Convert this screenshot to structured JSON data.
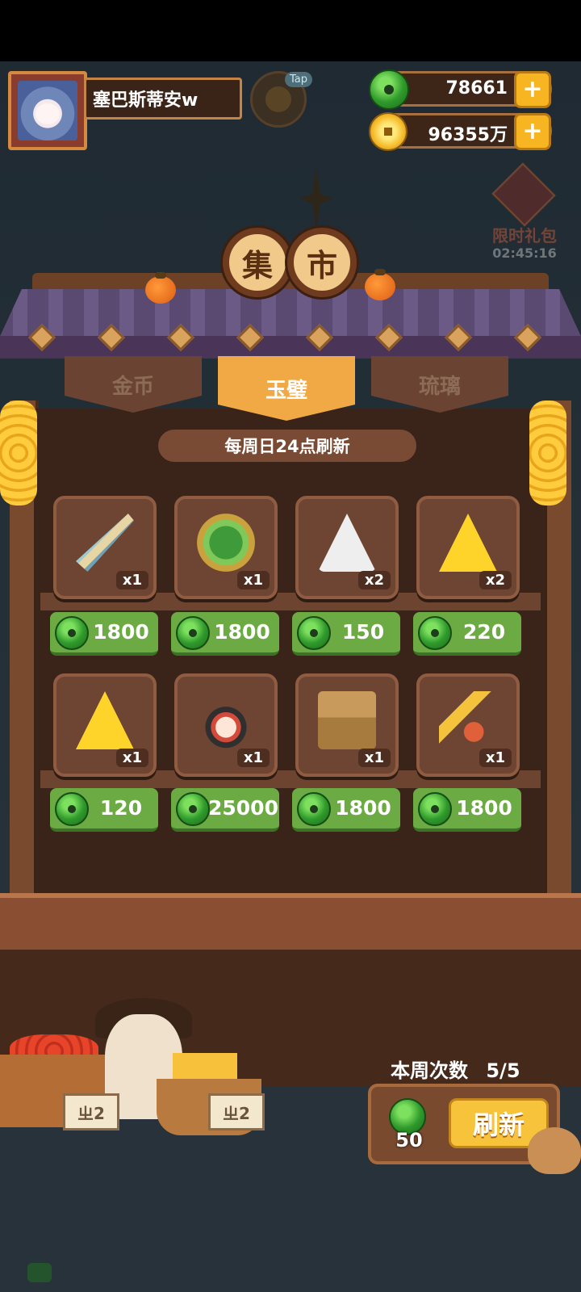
{
  "player": {
    "name": "塞巴斯蒂安w"
  },
  "tap_label": "Tap",
  "currencies": {
    "jade": "78661",
    "gold": "96355万"
  },
  "gift": {
    "label": "限时礼包",
    "timer": "02:45:16"
  },
  "market_title": [
    "集",
    "市"
  ],
  "tabs": [
    "金币",
    "玉璧",
    "琉璃"
  ],
  "active_tab": "玉璧",
  "refresh_note": "每周日24点刷新",
  "items_row1": [
    {
      "icon": "umbrella-item",
      "qty": "x1",
      "price": "1800"
    },
    {
      "icon": "jade-stone-item",
      "qty": "x1",
      "price": "1800"
    },
    {
      "icon": "white-talisman-item",
      "qty": "x2",
      "price": "150"
    },
    {
      "icon": "yellow-talisman-item",
      "qty": "x2",
      "price": "220"
    }
  ],
  "items_row2": [
    {
      "icon": "yellow-talisman-item",
      "qty": "x1",
      "price": "120"
    },
    {
      "icon": "character-doll-item",
      "qty": "x1",
      "price": "25000"
    },
    {
      "icon": "treasure-chest-item",
      "qty": "x1",
      "price": "1800"
    },
    {
      "icon": "key-item",
      "qty": "x1",
      "price": "1800"
    }
  ],
  "weekly": {
    "label": "本周次数",
    "count": "5/5"
  },
  "refresh": {
    "cost": "50",
    "button": "刷新"
  },
  "stall_tags": [
    "ㄓ2",
    "ㄓ2"
  ],
  "colors": {
    "price_green": "#6cab43",
    "tab_active": "#f0a944",
    "plus_yellow": "#f6b521"
  }
}
